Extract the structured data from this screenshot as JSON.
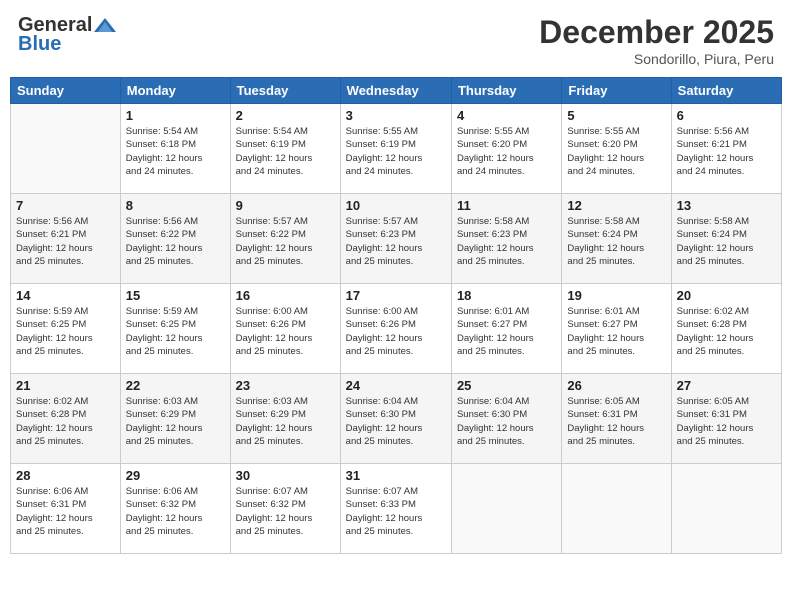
{
  "header": {
    "logo": {
      "line1": "General",
      "line2": "Blue"
    },
    "title": "December 2025",
    "location": "Sondorillo, Piura, Peru"
  },
  "calendar": {
    "days_of_week": [
      "Sunday",
      "Monday",
      "Tuesday",
      "Wednesday",
      "Thursday",
      "Friday",
      "Saturday"
    ],
    "weeks": [
      [
        {
          "day": "",
          "info": ""
        },
        {
          "day": "1",
          "info": "Sunrise: 5:54 AM\nSunset: 6:18 PM\nDaylight: 12 hours\nand 24 minutes."
        },
        {
          "day": "2",
          "info": "Sunrise: 5:54 AM\nSunset: 6:19 PM\nDaylight: 12 hours\nand 24 minutes."
        },
        {
          "day": "3",
          "info": "Sunrise: 5:55 AM\nSunset: 6:19 PM\nDaylight: 12 hours\nand 24 minutes."
        },
        {
          "day": "4",
          "info": "Sunrise: 5:55 AM\nSunset: 6:20 PM\nDaylight: 12 hours\nand 24 minutes."
        },
        {
          "day": "5",
          "info": "Sunrise: 5:55 AM\nSunset: 6:20 PM\nDaylight: 12 hours\nand 24 minutes."
        },
        {
          "day": "6",
          "info": "Sunrise: 5:56 AM\nSunset: 6:21 PM\nDaylight: 12 hours\nand 24 minutes."
        }
      ],
      [
        {
          "day": "7",
          "info": "Sunrise: 5:56 AM\nSunset: 6:21 PM\nDaylight: 12 hours\nand 25 minutes."
        },
        {
          "day": "8",
          "info": "Sunrise: 5:56 AM\nSunset: 6:22 PM\nDaylight: 12 hours\nand 25 minutes."
        },
        {
          "day": "9",
          "info": "Sunrise: 5:57 AM\nSunset: 6:22 PM\nDaylight: 12 hours\nand 25 minutes."
        },
        {
          "day": "10",
          "info": "Sunrise: 5:57 AM\nSunset: 6:23 PM\nDaylight: 12 hours\nand 25 minutes."
        },
        {
          "day": "11",
          "info": "Sunrise: 5:58 AM\nSunset: 6:23 PM\nDaylight: 12 hours\nand 25 minutes."
        },
        {
          "day": "12",
          "info": "Sunrise: 5:58 AM\nSunset: 6:24 PM\nDaylight: 12 hours\nand 25 minutes."
        },
        {
          "day": "13",
          "info": "Sunrise: 5:58 AM\nSunset: 6:24 PM\nDaylight: 12 hours\nand 25 minutes."
        }
      ],
      [
        {
          "day": "14",
          "info": "Sunrise: 5:59 AM\nSunset: 6:25 PM\nDaylight: 12 hours\nand 25 minutes."
        },
        {
          "day": "15",
          "info": "Sunrise: 5:59 AM\nSunset: 6:25 PM\nDaylight: 12 hours\nand 25 minutes."
        },
        {
          "day": "16",
          "info": "Sunrise: 6:00 AM\nSunset: 6:26 PM\nDaylight: 12 hours\nand 25 minutes."
        },
        {
          "day": "17",
          "info": "Sunrise: 6:00 AM\nSunset: 6:26 PM\nDaylight: 12 hours\nand 25 minutes."
        },
        {
          "day": "18",
          "info": "Sunrise: 6:01 AM\nSunset: 6:27 PM\nDaylight: 12 hours\nand 25 minutes."
        },
        {
          "day": "19",
          "info": "Sunrise: 6:01 AM\nSunset: 6:27 PM\nDaylight: 12 hours\nand 25 minutes."
        },
        {
          "day": "20",
          "info": "Sunrise: 6:02 AM\nSunset: 6:28 PM\nDaylight: 12 hours\nand 25 minutes."
        }
      ],
      [
        {
          "day": "21",
          "info": "Sunrise: 6:02 AM\nSunset: 6:28 PM\nDaylight: 12 hours\nand 25 minutes."
        },
        {
          "day": "22",
          "info": "Sunrise: 6:03 AM\nSunset: 6:29 PM\nDaylight: 12 hours\nand 25 minutes."
        },
        {
          "day": "23",
          "info": "Sunrise: 6:03 AM\nSunset: 6:29 PM\nDaylight: 12 hours\nand 25 minutes."
        },
        {
          "day": "24",
          "info": "Sunrise: 6:04 AM\nSunset: 6:30 PM\nDaylight: 12 hours\nand 25 minutes."
        },
        {
          "day": "25",
          "info": "Sunrise: 6:04 AM\nSunset: 6:30 PM\nDaylight: 12 hours\nand 25 minutes."
        },
        {
          "day": "26",
          "info": "Sunrise: 6:05 AM\nSunset: 6:31 PM\nDaylight: 12 hours\nand 25 minutes."
        },
        {
          "day": "27",
          "info": "Sunrise: 6:05 AM\nSunset: 6:31 PM\nDaylight: 12 hours\nand 25 minutes."
        }
      ],
      [
        {
          "day": "28",
          "info": "Sunrise: 6:06 AM\nSunset: 6:31 PM\nDaylight: 12 hours\nand 25 minutes."
        },
        {
          "day": "29",
          "info": "Sunrise: 6:06 AM\nSunset: 6:32 PM\nDaylight: 12 hours\nand 25 minutes."
        },
        {
          "day": "30",
          "info": "Sunrise: 6:07 AM\nSunset: 6:32 PM\nDaylight: 12 hours\nand 25 minutes."
        },
        {
          "day": "31",
          "info": "Sunrise: 6:07 AM\nSunset: 6:33 PM\nDaylight: 12 hours\nand 25 minutes."
        },
        {
          "day": "",
          "info": ""
        },
        {
          "day": "",
          "info": ""
        },
        {
          "day": "",
          "info": ""
        }
      ]
    ]
  }
}
